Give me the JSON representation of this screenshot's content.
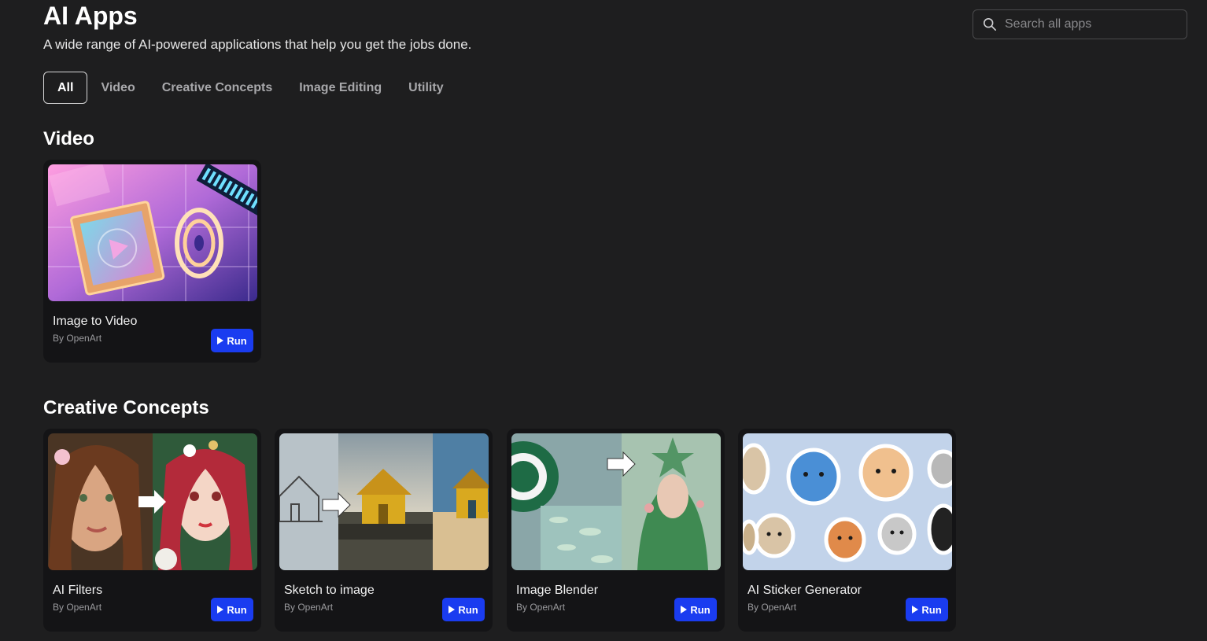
{
  "header": {
    "title": "AI Apps",
    "subtitle": "A wide range of AI-powered applications that help you get the jobs done."
  },
  "search": {
    "placeholder": "Search all apps",
    "icon": "search-icon"
  },
  "tabs": [
    {
      "label": "All",
      "active": true
    },
    {
      "label": "Video"
    },
    {
      "label": "Creative Concepts"
    },
    {
      "label": "Image Editing"
    },
    {
      "label": "Utility"
    }
  ],
  "sections": [
    {
      "title": "Video",
      "cards": [
        {
          "title": "Image to Video",
          "by": "By OpenArt",
          "run_label": "Run"
        }
      ]
    },
    {
      "title": "Creative Concepts",
      "cards": [
        {
          "title": "AI Filters",
          "by": "By OpenArt",
          "run_label": "Run"
        },
        {
          "title": "Sketch to image",
          "by": "By OpenArt",
          "run_label": "Run"
        },
        {
          "title": "Image Blender",
          "by": "By OpenArt",
          "run_label": "Run"
        },
        {
          "title": "AI Sticker Generator",
          "by": "By OpenArt",
          "run_label": "Run"
        }
      ]
    }
  ],
  "colors": {
    "background": "#1e1e1f",
    "card": "#141416",
    "run_button": "#1a3cf0"
  }
}
